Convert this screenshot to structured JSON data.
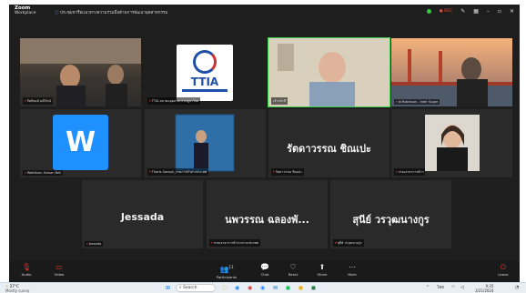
{
  "window": {
    "brand_top": "Zoom",
    "brand_bottom": "Workplace",
    "meeting_title": "ประชุมหารือแนวทางความร่วมมือด้านการพัฒนาอุตสาหกรรม",
    "rec_label": "REC",
    "colors": {
      "accent_green": "#3bd14b",
      "mic_muted": "#e53935"
    }
  },
  "tiles": [
    {
      "name": "กิตติพงษ์ มณีรัตน์",
      "type": "video",
      "muted": true
    },
    {
      "name": "TTIA สมาคมอุตสาหกรรมทูน่าไทย",
      "type": "logo",
      "logo_text": "TTIA",
      "muted": true
    },
    {
      "name": "เจ้าหน้าที่",
      "type": "video",
      "muted": false,
      "speaking": true
    },
    {
      "name": "Jo Robinson - Inter Sugar",
      "type": "video",
      "muted": true
    },
    {
      "name": "Wattikorn Sresan Bell",
      "type": "avatar",
      "avatar_letter": "W",
      "muted": true
    },
    {
      "name": "Tharis Sansuk_กรมการค้าต่างประเทศ",
      "type": "video",
      "muted": true
    },
    {
      "name": "รัตดาวรรณ ชิณเปะ",
      "type": "name",
      "display": "รัตดาวรรณ ชิณเปะ",
      "muted": true
    },
    {
      "name": "กรมเจรจาการค้าฯ",
      "type": "video",
      "muted": true
    },
    {
      "name": "Jessada",
      "type": "name",
      "display": "Jessada",
      "muted": true
    },
    {
      "name": "กรมเจรจาการค้าระหว่างประเทศ",
      "type": "name",
      "display": "นพวรรณ ฉลองพั...",
      "muted": true
    },
    {
      "name": "สุนีย์ วรวุฒนางกูร",
      "type": "name",
      "display": "สุนีย์ วรวุฒนางกูร",
      "muted": true
    }
  ],
  "toolbar": {
    "audio": "Audio",
    "video": "Video",
    "participants": "Participants",
    "participants_count": "11",
    "chat": "Chat",
    "react": "React",
    "share": "Share",
    "more": "More",
    "leave": "Leave"
  },
  "taskbar": {
    "weather": "27°C",
    "weather_sub": "Mostly sunny",
    "search": "Search",
    "lang": "ไทย",
    "time": "9:35",
    "date": "3/21/2024"
  }
}
